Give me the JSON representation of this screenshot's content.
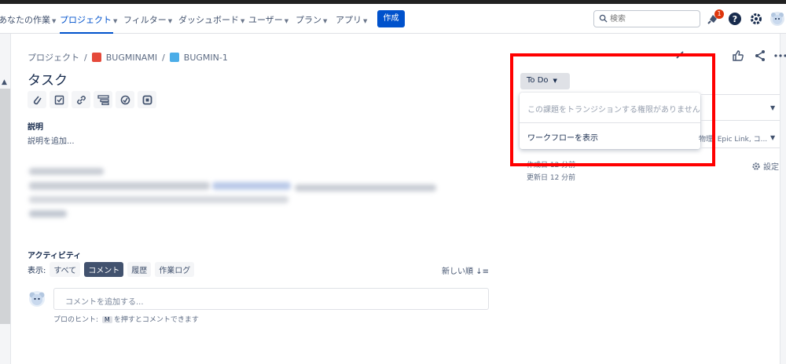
{
  "nav": {
    "items": [
      {
        "label": "あなたの作業"
      },
      {
        "label": "プロジェクト"
      },
      {
        "label": "フィルター"
      },
      {
        "label": "ダッシュボード"
      },
      {
        "label": "ユーザー"
      },
      {
        "label": "プラン"
      },
      {
        "label": "アプリ"
      }
    ],
    "create_label": "作成",
    "search_placeholder": "検索",
    "notification_count": "1"
  },
  "breadcrumb": {
    "root": "プロジェクト",
    "sep": "/",
    "project": "BUGMINAMI",
    "issue": "BUGMIN-1"
  },
  "issue": {
    "title": "タスク",
    "description_label": "説明",
    "description_placeholder": "説明を追加..."
  },
  "activity": {
    "label": "アクティビティ",
    "show_label": "表示:",
    "tabs": [
      "すべて",
      "コメント",
      "履歴",
      "作業ログ"
    ],
    "sort_label": "新しい順",
    "comment_placeholder": "コメントを追加する...",
    "hint_prefix": "プロのヒント:",
    "hint_key": "M",
    "hint_suffix": "を押すとコメントできます"
  },
  "sidebar": {
    "status_label": "To Do",
    "dropdown": {
      "no_permission": "この課題をトランジションする権限がありません",
      "view_workflow": "ワークフローを表示"
    },
    "fields_text": "物理, Epic Link, コ...",
    "created": "作成日 12 分前",
    "updated": "更新日 12 分前",
    "settings_label": "設定"
  },
  "colors": {
    "brand": "#0052cc",
    "highlight": "#ff0000"
  }
}
